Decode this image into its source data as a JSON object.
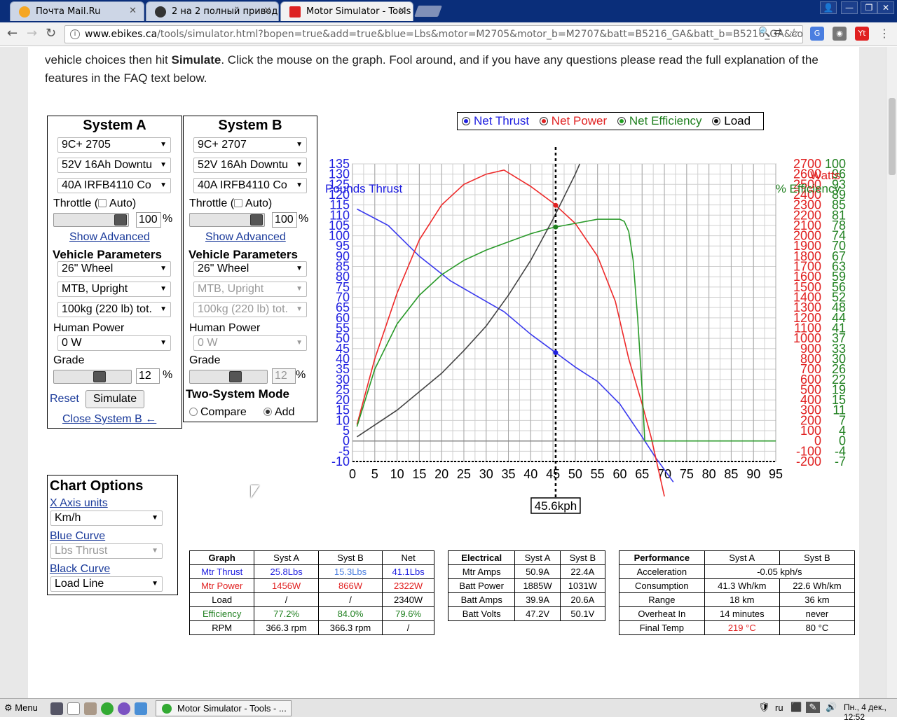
{
  "browser": {
    "tabs": [
      {
        "title": "Почта Mail.Ru",
        "active": false
      },
      {
        "title": "2 на 2 полный привод",
        "active": false
      },
      {
        "title": "Motor Simulator - Tools",
        "active": true
      }
    ],
    "url_host": "www.ebikes.ca",
    "url_rest": "/tools/simulator.html?bopen=true&add=true&blue=Lbs&motor=M2705&motor_b=M2707&batt=B5216_GA&batt_b=B5216_GA&cont"
  },
  "intro_text_1": "vehicle choices then hit ",
  "intro_bold": "Simulate",
  "intro_text_2": ". Click the mouse on the graph. Fool around, and if you have any questions please read the full explanation of the features in the FAQ text below.",
  "system_a": {
    "title": "System A",
    "motor": "9C+ 2705",
    "battery": "52V 16Ah Downtu",
    "controller": "40A IRFB4110 Co",
    "throttle_label": "Throttle (",
    "auto_label": "Auto)",
    "throttle_value": "100",
    "percent": "%",
    "show_advanced": "Show Advanced",
    "vehicle_params": "Vehicle Parameters",
    "wheel": "26\"  Wheel",
    "style": "MTB, Upright",
    "weight": "100kg (220 lb) tot.",
    "human_power_label": "Human Power",
    "human_power": "0 W",
    "grade_label": "Grade",
    "grade_value": "12",
    "throttle_fraction": 1.0,
    "grade_fraction": 0.62,
    "reset": "Reset",
    "simulate": "Simulate",
    "close_b": "Close System B ←"
  },
  "system_b": {
    "title": "System B",
    "motor": "9C+ 2707",
    "battery": "52V 16Ah Downtu",
    "controller": "40A IRFB4110 Co",
    "throttle_label": "Throttle (",
    "auto_label": "Auto)",
    "throttle_value": "100",
    "percent": "%",
    "show_advanced": "Show Advanced",
    "vehicle_params": "Vehicle Parameters",
    "wheel": "26\"  Wheel",
    "style": "MTB, Upright",
    "weight": "100kg (220 lb) tot.",
    "human_power_label": "Human Power",
    "human_power": "0 W",
    "grade_label": "Grade",
    "grade_value": "12",
    "throttle_fraction": 1.0,
    "grade_fraction": 0.62,
    "two_system_mode": "Two-System Mode",
    "compare": "Compare",
    "add": "Add"
  },
  "chart_options": {
    "title": "Chart Options",
    "x_axis_label": "X Axis units",
    "x_axis_value": "Km/h",
    "blue_label": "Blue Curve",
    "blue_value": "Lbs Thrust",
    "black_label": "Black Curve",
    "black_value": "Load Line"
  },
  "legend": {
    "net_thrust": "Net Thrust",
    "net_power": "Net Power",
    "net_efficiency": "Net Efficiency",
    "load": "Load"
  },
  "chart_data": {
    "type": "line",
    "left_axis_label": "Pounds Thrust",
    "right_axis_label_1": "Watts",
    "right_axis_label_2": "% Efficiency",
    "x_ticks": [
      0,
      5,
      10,
      15,
      20,
      25,
      30,
      35,
      40,
      45,
      50,
      55,
      60,
      65,
      70,
      75,
      80,
      85,
      90,
      95
    ],
    "xlim": [
      0,
      95
    ],
    "y_left_ticks": [
      135,
      130,
      125,
      120,
      115,
      110,
      105,
      100,
      95,
      90,
      85,
      80,
      75,
      70,
      65,
      60,
      55,
      50,
      45,
      40,
      35,
      30,
      25,
      20,
      15,
      10,
      5,
      0,
      -5,
      -10
    ],
    "ylim_left": [
      -10,
      135
    ],
    "y_watts_ticks": [
      2700,
      2600,
      2500,
      2400,
      2300,
      2200,
      2100,
      2000,
      1900,
      1800,
      1700,
      1600,
      1500,
      1400,
      1300,
      1200,
      1100,
      1000,
      900,
      800,
      700,
      600,
      500,
      400,
      300,
      200,
      100,
      0,
      -100,
      -200
    ],
    "y_eff_ticks": [
      100,
      96,
      93,
      89,
      85,
      81,
      78,
      74,
      70,
      67,
      63,
      59,
      56,
      52,
      48,
      44,
      41,
      37,
      33,
      30,
      26,
      22,
      19,
      15,
      11,
      7,
      4,
      0,
      -4,
      -7
    ],
    "cursor_x": 45.6,
    "cursor_label": "45.6kph",
    "series": [
      {
        "name": "Net Thrust",
        "color": "#3a3aee",
        "points": [
          [
            1,
            113
          ],
          [
            8,
            105
          ],
          [
            15,
            90
          ],
          [
            22,
            78
          ],
          [
            30,
            68
          ],
          [
            34,
            63
          ],
          [
            40,
            52
          ],
          [
            45,
            44
          ],
          [
            50,
            36
          ],
          [
            55,
            29
          ],
          [
            60,
            18
          ],
          [
            65,
            2
          ],
          [
            68,
            -8
          ],
          [
            72,
            -20
          ]
        ]
      },
      {
        "name": "Net Power",
        "color": "#ee2a2a",
        "points": [
          [
            1,
            8
          ],
          [
            5,
            40
          ],
          [
            10,
            72
          ],
          [
            15,
            98
          ],
          [
            20,
            115
          ],
          [
            25,
            125
          ],
          [
            30,
            130
          ],
          [
            34,
            132
          ],
          [
            40,
            124
          ],
          [
            45,
            116
          ],
          [
            50,
            106
          ],
          [
            55,
            90
          ],
          [
            59,
            68
          ],
          [
            62,
            40
          ],
          [
            65,
            18
          ],
          [
            67,
            2
          ],
          [
            70,
            -27
          ]
        ]
      },
      {
        "name": "Net Efficiency",
        "color": "#2a9a2a",
        "points": [
          [
            1,
            7
          ],
          [
            5,
            35
          ],
          [
            10,
            57
          ],
          [
            15,
            71
          ],
          [
            20,
            81
          ],
          [
            25,
            88
          ],
          [
            30,
            93
          ],
          [
            35,
            97
          ],
          [
            40,
            101
          ],
          [
            45,
            104
          ],
          [
            50,
            106
          ],
          [
            55,
            108
          ],
          [
            58,
            108
          ],
          [
            60,
            108
          ],
          [
            61,
            107
          ],
          [
            62,
            102
          ],
          [
            63,
            88
          ],
          [
            64,
            60
          ],
          [
            65,
            25
          ],
          [
            65.6,
            0
          ],
          [
            70,
            0
          ],
          [
            95,
            0
          ]
        ]
      },
      {
        "name": "Load",
        "color": "#444444",
        "points": [
          [
            1,
            2
          ],
          [
            10,
            15
          ],
          [
            20,
            33
          ],
          [
            25,
            44
          ],
          [
            30,
            56
          ],
          [
            35,
            71
          ],
          [
            40,
            88
          ],
          [
            45,
            108
          ],
          [
            50,
            130
          ],
          [
            51,
            135
          ]
        ]
      }
    ]
  },
  "table_graph": {
    "headers": [
      "Graph",
      "Syst A",
      "Syst B",
      "Net"
    ],
    "rows": [
      [
        "Mtr Thrust",
        "25.8Lbs",
        "15.3Lbs",
        "41.1Lbs"
      ],
      [
        "Mtr Power",
        "1456W",
        "866W",
        "2322W"
      ],
      [
        "Load",
        "/",
        "/",
        "2340W"
      ],
      [
        "Efficiency",
        "77.2%",
        "84.0%",
        "79.6%"
      ],
      [
        "RPM",
        "366.3 rpm",
        "366.3 rpm",
        "/"
      ]
    ]
  },
  "table_electrical": {
    "headers": [
      "Electrical",
      "Syst A",
      "Syst B"
    ],
    "rows": [
      [
        "Mtr Amps",
        "50.9A",
        "22.4A"
      ],
      [
        "Batt Power",
        "1885W",
        "1031W"
      ],
      [
        "Batt Amps",
        "39.9A",
        "20.6A"
      ],
      [
        "Batt Volts",
        "47.2V",
        "50.1V"
      ]
    ]
  },
  "table_performance": {
    "headers": [
      "Performance",
      "Syst A",
      "Syst B"
    ],
    "acceleration_label": "Acceleration",
    "acceleration": "-0.05 kph/s",
    "rows": [
      [
        "Consumption",
        "41.3 Wh/km",
        "22.6 Wh/km"
      ],
      [
        "Range",
        "18 km",
        "36 km"
      ],
      [
        "Overheat In",
        "14 minutes",
        "never"
      ],
      [
        "Final Temp",
        "219 °C",
        "80 °C"
      ]
    ]
  },
  "taskbar": {
    "menu": "Menu",
    "window_title": "Motor Simulator - Tools - ...",
    "lang": "ru",
    "clock": "Пн., 4 дек., 12:52"
  }
}
